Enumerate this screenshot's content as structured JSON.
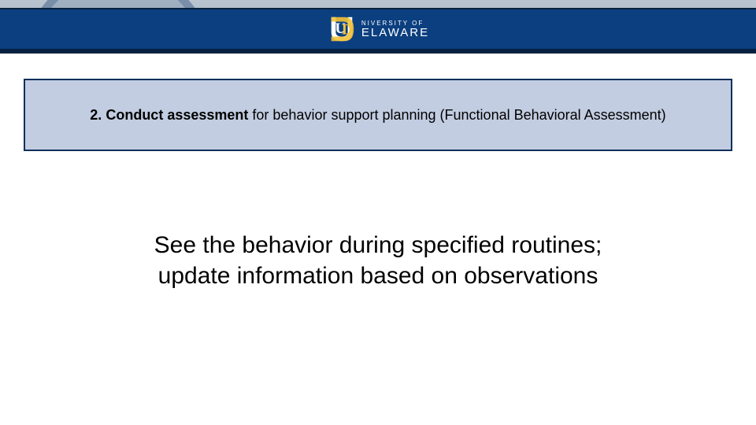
{
  "header": {
    "logo_top": "NIVERSITY OF",
    "logo_bottom": "ELAWARE"
  },
  "banner": {
    "number": "2.",
    "bold": "Conduct assessment",
    "rest": " for behavior support planning (Functional Behavioral Assessment)"
  },
  "body": {
    "line1": "See the behavior during specified routines;",
    "line2": "update information based on observations"
  }
}
